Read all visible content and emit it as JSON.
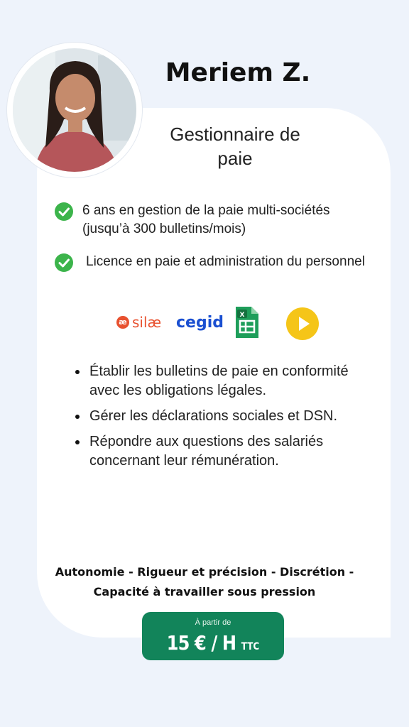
{
  "profile": {
    "name": "Meriem Z.",
    "role": "Gestionnaire de paie"
  },
  "highlights": [
    "6 ans en gestion de la paie multi-sociétés (jusqu’à 300 bulletins/mois)",
    "Licence en paie et administration du personnel"
  ],
  "tools": [
    {
      "name": "silæ",
      "icon": "silae-logo"
    },
    {
      "name": "cegid",
      "icon": "cegid-logo"
    },
    {
      "name": "Google Sheets",
      "icon": "sheets-icon"
    },
    {
      "name": "Play",
      "icon": "play-icon"
    }
  ],
  "tasks": [
    "Établir les bulletins de paie en conformité avec les obligations légales.",
    "Gérer les déclarations sociales et DSN.",
    "Répondre aux questions des salariés concernant leur rémunération."
  ],
  "skills_line_1": "Autonomie - Rigueur et précision - Discrétion -",
  "skills_line_2": "Capacité à travailler sous pression",
  "price": {
    "from_label": "À partir de",
    "amount": "15 € / H",
    "suffix": "TTC"
  },
  "colors": {
    "background": "#eef3fb",
    "check_green": "#3cb44b",
    "price_green": "#12845a",
    "silae_orange": "#e8512f",
    "cegid_blue": "#1a4fd1",
    "play_yellow": "#f5c518"
  }
}
